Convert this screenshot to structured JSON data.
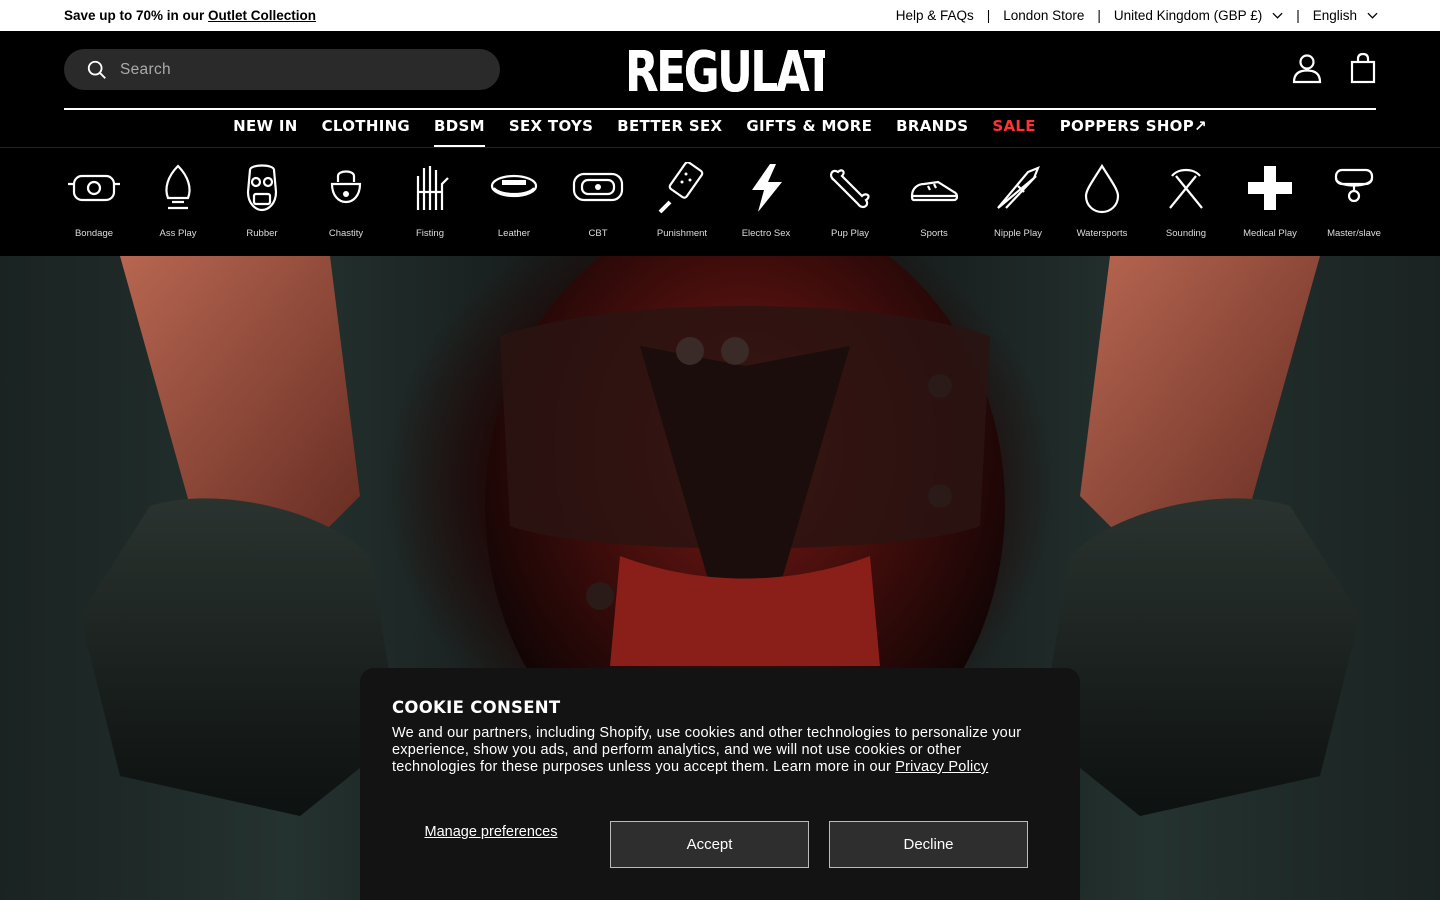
{
  "announcement": {
    "text": "Save up to 70% in our",
    "link": "Outlet Collection"
  },
  "utility": {
    "help": "Help & FAQs",
    "store": "London Store",
    "currency": "United Kingdom (GBP £)",
    "language": "English",
    "separator": "|"
  },
  "header": {
    "search_placeholder": "Search",
    "logo": "REGULATION",
    "account_icon": "user-icon",
    "cart_icon": "bag-icon"
  },
  "nav": [
    {
      "label": "NEW IN",
      "active": false
    },
    {
      "label": "CLOTHING",
      "active": false
    },
    {
      "label": "BDSM",
      "active": true
    },
    {
      "label": "SEX TOYS",
      "active": false
    },
    {
      "label": "BETTER SEX",
      "active": false
    },
    {
      "label": "GIFTS & MORE",
      "active": false
    },
    {
      "label": "BRANDS",
      "active": false
    },
    {
      "label": "SALE",
      "active": false
    },
    {
      "label": "POPPERS SHOP↗",
      "active": false
    }
  ],
  "categories": [
    {
      "label": "Bondage",
      "icon": "bondage-icon"
    },
    {
      "label": "Ass Play",
      "icon": "plug-icon"
    },
    {
      "label": "Rubber",
      "icon": "gas-mask-icon"
    },
    {
      "label": "Chastity",
      "icon": "padlock-icon"
    },
    {
      "label": "Fisting",
      "icon": "fist-icon"
    },
    {
      "label": "Leather",
      "icon": "cap-icon"
    },
    {
      "label": "CBT",
      "icon": "cbt-icon"
    },
    {
      "label": "Punishment",
      "icon": "paddle-icon"
    },
    {
      "label": "Electro Sex",
      "icon": "lightning-icon"
    },
    {
      "label": "Pup Play",
      "icon": "bone-icon"
    },
    {
      "label": "Sports",
      "icon": "sneaker-icon"
    },
    {
      "label": "Nipple Play",
      "icon": "clamp-icon"
    },
    {
      "label": "Watersports",
      "icon": "droplet-icon"
    },
    {
      "label": "Sounding",
      "icon": "sounding-icon"
    },
    {
      "label": "Medical Play",
      "icon": "cross-icon"
    },
    {
      "label": "Master/slave",
      "icon": "collar-icon"
    }
  ],
  "cookie": {
    "title": "COOKIE CONSENT",
    "body": "We and our partners, including Shopify, use cookies and other technologies to personalize your experience, show you ads, and perform analytics, and we will not use cookies or other technologies for these purposes unless you accept them. Learn more in our",
    "privacy_link": "Privacy Policy",
    "manage": "Manage preferences",
    "accept": "Accept",
    "decline": "Decline"
  },
  "colors": {
    "sale": "#ff3333",
    "background": "#000000",
    "topbar": "#ffffff"
  }
}
